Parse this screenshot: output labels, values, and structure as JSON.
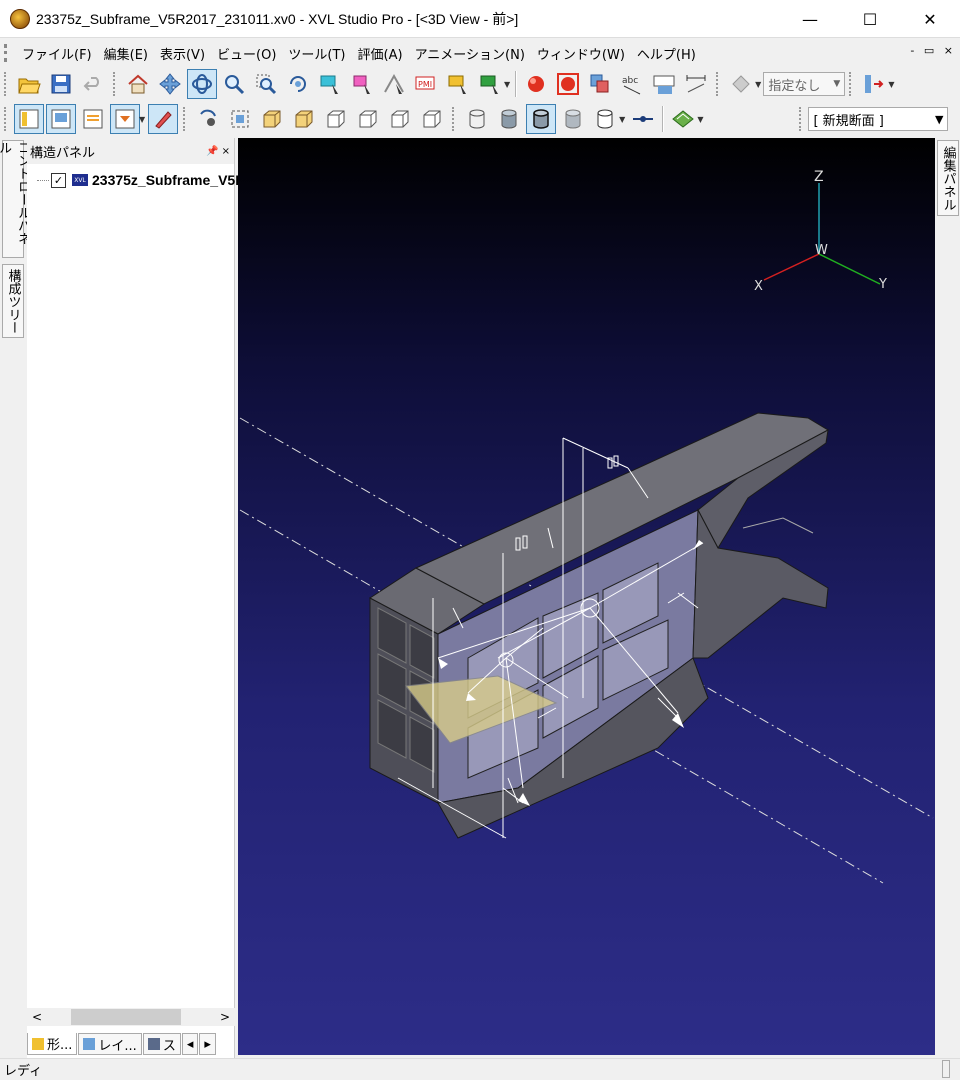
{
  "window": {
    "title": "23375z_Subframe_V5R2017_231011.xv0 - XVL Studio Pro - [<3D View - 前>]",
    "min_glyph": "—",
    "max_glyph": "☐",
    "close_glyph": "✕"
  },
  "menu": {
    "items": [
      "ファイル(F)",
      "編集(E)",
      "表示(V)",
      "ビュー(O)",
      "ツール(T)",
      "評価(A)",
      "アニメーション(N)",
      "ウィンドウ(W)",
      "ヘルプ(H)"
    ],
    "mdi_controls": "- ▭ ×"
  },
  "toolbar": {
    "designation_combo": "指定なし",
    "section_combo": "[ 新規断面 ]"
  },
  "side_tabs": {
    "control_panel": "コントロールパネル",
    "structure_tree": "構成ツリー",
    "edit_panel": "編集パネル"
  },
  "structure_panel": {
    "title": "構造パネル",
    "controls": "📌 ×",
    "tree_item": "23375z_Subframe_V5I",
    "tree_item_icon": "XVL",
    "checked_mark": "✓",
    "bottom_tabs": [
      "形...",
      "レイ...",
      "ス"
    ]
  },
  "axes": {
    "z": "Z",
    "w": "W",
    "x": "X",
    "y": "Y"
  },
  "status": {
    "text": "レディ"
  },
  "colors": {
    "viewport_top": "#000000",
    "viewport_bottom": "#2d2d88",
    "axis_x": "#d42020",
    "axis_y": "#20b020",
    "axis_z": "#20a0b0",
    "model_face": "#5e5e66",
    "model_inner": "#8888aa"
  }
}
